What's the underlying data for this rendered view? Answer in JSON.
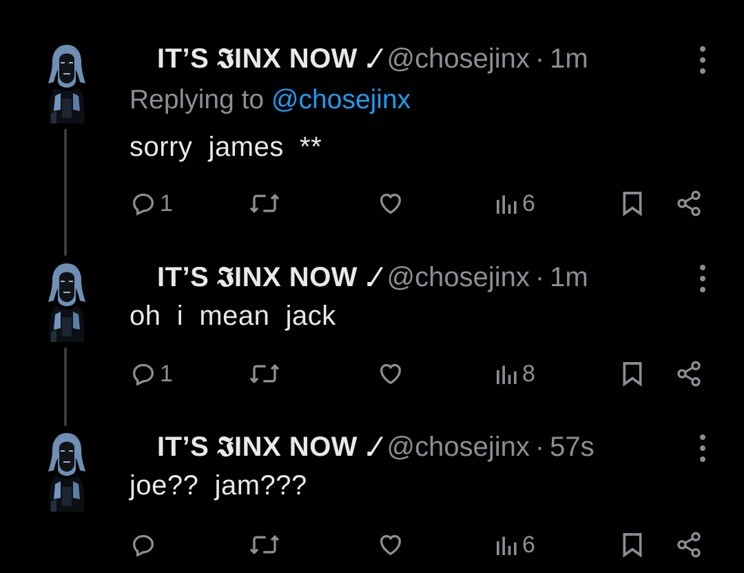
{
  "tweets": [
    {
      "display_name": "IT’S 𝕴INX NOW .⁄",
      "handle": "@chosejinx",
      "separator": "·",
      "time": "1m",
      "replying_prefix": "Replying to",
      "replying_to": "@chosejinx",
      "text": "sorry  james  **",
      "reply_count": "1",
      "view_count": "6"
    },
    {
      "display_name": "IT’S 𝕴INX NOW .⁄",
      "handle": "@chosejinx",
      "separator": "·",
      "time": "1m",
      "text": "oh  i  mean  jack",
      "reply_count": "1",
      "view_count": "8"
    },
    {
      "display_name": "IT’S 𝕴INX NOW .⁄",
      "handle": "@chosejinx",
      "separator": "·",
      "time": "57s",
      "text": "joe??  jam???",
      "reply_count": "",
      "view_count": "6"
    }
  ],
  "icons": {
    "reply": "reply-icon",
    "retweet": "retweet-icon",
    "like": "heart-icon",
    "views": "views-icon",
    "bookmark": "bookmark-icon",
    "share": "share-icon",
    "more": "more-icon"
  },
  "colors": {
    "background": "#000000",
    "text": "#e7e9ea",
    "muted": "#8b8f94",
    "mention": "#1d9bf0"
  }
}
